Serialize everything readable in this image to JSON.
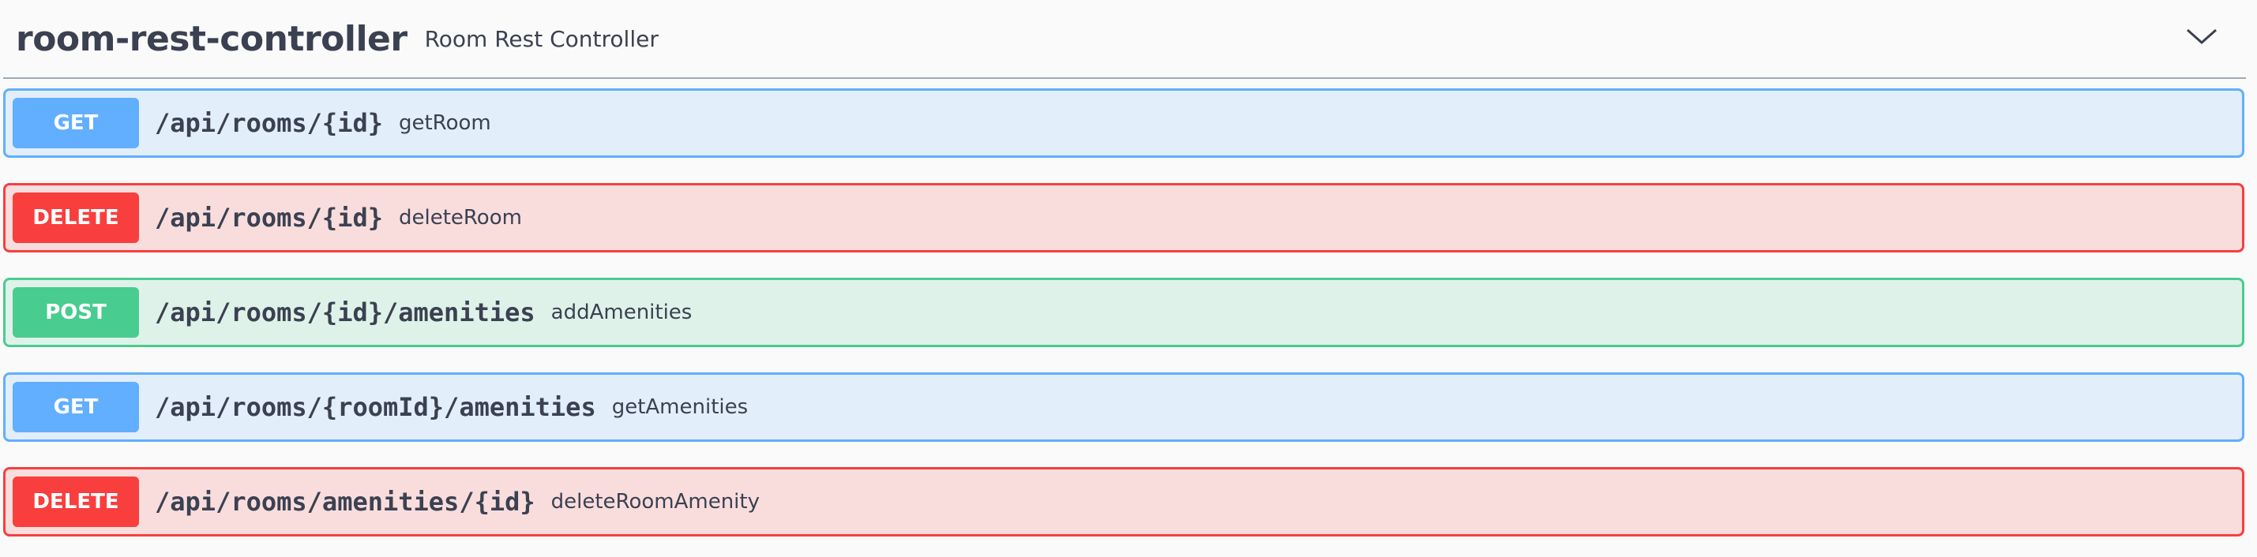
{
  "tag": {
    "name": "room-rest-controller",
    "description": "Room Rest Controller",
    "toggle_icon": "chevron-down-icon"
  },
  "operations": [
    {
      "method": "GET",
      "path": "/api/rooms/{id}",
      "summary": "getRoom"
    },
    {
      "method": "DELETE",
      "path": "/api/rooms/{id}",
      "summary": "deleteRoom"
    },
    {
      "method": "POST",
      "path": "/api/rooms/{id}/amenities",
      "summary": "addAmenities"
    },
    {
      "method": "GET",
      "path": "/api/rooms/{roomId}/amenities",
      "summary": "getAmenities"
    },
    {
      "method": "DELETE",
      "path": "/api/rooms/amenities/{id}",
      "summary": "deleteRoomAmenity"
    }
  ],
  "colors": {
    "get": "#61affe",
    "delete": "#f93e3e",
    "post": "#49cc90",
    "text": "#3b4151"
  }
}
